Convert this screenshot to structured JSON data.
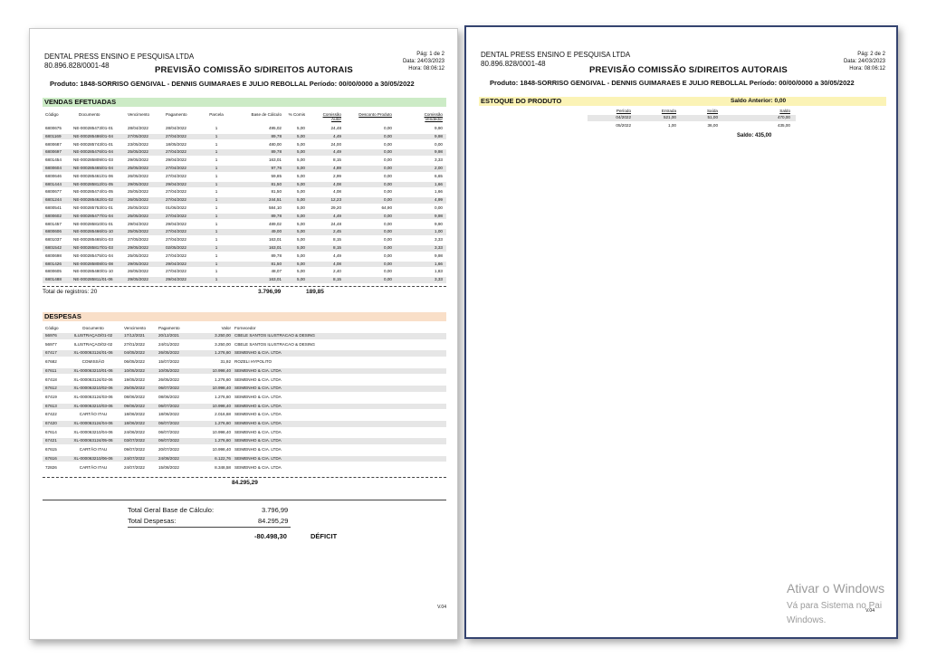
{
  "page1": {
    "company": "DENTAL PRESS ENSINO E PESQUISA LTDA",
    "cnpj": "80.896.828/0001-48",
    "page_label": "Pág: 1 de 2",
    "date_label": "Data: 24/03/2023",
    "time_label": "Hora: 08:06:12",
    "title": "PREVISÃO COMISSÃO S/DIREITOS AUTORAIS",
    "product_line": "Produto: 1848-SORRISO GENGIVAL - DENNIS GUIMARAES E JULIO REBOLLAL  Período: 00/00/0000 a 30/05/2022",
    "vendas": {
      "header": "VENDAS EFETUADAS",
      "cols": [
        "Código",
        "Documento",
        "Vencimento",
        "Pagamento",
        "Parcela",
        "Base de Cálculo",
        "% Comis",
        "Comissão Autor",
        "Desconto Produto",
        "Comissão Vendedor"
      ],
      "rows": [
        [
          "6800675",
          "NE-000285473/01-01",
          "28/04/2022",
          "28/04/2022",
          "1",
          "495,02",
          "5,00",
          "24,48",
          "0,00",
          "9,90"
        ],
        [
          "6801169",
          "NE-000285486/01-04",
          "27/05/2022",
          "27/04/2022",
          "1",
          "89,78",
          "5,00",
          "4,49",
          "0,00",
          "9,98"
        ],
        [
          "6800687",
          "NE-000285743/01-01",
          "23/05/2022",
          "18/05/2022",
          "1",
          "480,00",
          "5,00",
          "24,00",
          "0,00",
          "0,00"
        ],
        [
          "6800697",
          "NE-000285476/01-04",
          "25/05/2022",
          "27/04/2022",
          "1",
          "89,78",
          "5,00",
          "4,49",
          "0,00",
          "9,98"
        ],
        [
          "6801454",
          "NE-000285809/01-03",
          "29/05/2022",
          "29/04/2022",
          "1",
          "163,01",
          "5,00",
          "8,15",
          "0,00",
          "3,33"
        ],
        [
          "6800604",
          "NE-000285465/01-04",
          "25/05/2022",
          "27/04/2022",
          "1",
          "97,76",
          "5,00",
          "4,89",
          "0,00",
          "2,00"
        ],
        [
          "6800646",
          "NE-000285461/01-06",
          "26/05/2022",
          "27/04/2022",
          "1",
          "59,85",
          "5,00",
          "2,99",
          "0,00",
          "6,65"
        ],
        [
          "6801444",
          "NE-000285812/01-05",
          "29/05/2022",
          "29/04/2022",
          "1",
          "81,50",
          "5,00",
          "4,08",
          "0,00",
          "1,66"
        ],
        [
          "6800677",
          "NE-000285474/01-05",
          "25/05/2022",
          "27/04/2022",
          "1",
          "81,50",
          "5,00",
          "4,08",
          "0,00",
          "1,66"
        ],
        [
          "6801244",
          "NE-000285462/01-02",
          "26/05/2022",
          "27/04/2022",
          "1",
          "244,51",
          "5,00",
          "12,23",
          "0,00",
          "4,99"
        ],
        [
          "6800541",
          "NE-000285753/01-01",
          "25/05/2022",
          "01/06/2022",
          "1",
          "584,10",
          "5,00",
          "29,20",
          "64,90",
          "0,00"
        ],
        [
          "6800602",
          "NE-000285477/01-04",
          "25/05/2022",
          "27/04/2022",
          "1",
          "89,78",
          "5,00",
          "4,49",
          "0,00",
          "9,98"
        ],
        [
          "6801457",
          "NE-000285810/01-01",
          "29/04/2022",
          "29/04/2022",
          "1",
          "489,02",
          "5,00",
          "24,48",
          "0,00",
          "9,90"
        ],
        [
          "6800606",
          "NE-000285466/01-10",
          "25/05/2022",
          "27/04/2022",
          "1",
          "49,00",
          "5,00",
          "2,45",
          "0,00",
          "1,00"
        ],
        [
          "6801037",
          "NE-000285465/01-03",
          "27/05/2022",
          "27/04/2022",
          "1",
          "163,01",
          "5,00",
          "8,15",
          "0,00",
          "3,33"
        ],
        [
          "6801542",
          "NE-000285817/01-03",
          "29/05/2022",
          "02/05/2022",
          "1",
          "163,01",
          "5,00",
          "8,15",
          "0,00",
          "3,33"
        ],
        [
          "6800698",
          "NE-000285475/01-04",
          "25/05/2022",
          "27/04/2022",
          "1",
          "89,78",
          "5,00",
          "4,49",
          "0,00",
          "9,98"
        ],
        [
          "6801426",
          "NE-000285808/01-08",
          "29/05/2022",
          "29/04/2022",
          "1",
          "81,50",
          "5,00",
          "4,08",
          "0,00",
          "1,66"
        ],
        [
          "6800605",
          "NE-000285480/01-10",
          "26/05/2022",
          "27/04/2022",
          "1",
          "48,07",
          "5,00",
          "2,40",
          "0,00",
          "1,83"
        ],
        [
          "6801488",
          "NE-000285811/01-06",
          "29/05/2022",
          "29/04/2022",
          "1",
          "163,01",
          "5,00",
          "8,15",
          "0,00",
          "3,33"
        ]
      ],
      "total_label": "Total de registros: 20",
      "total_base": "3.796,99",
      "total_comissao": "189,85"
    },
    "despesas": {
      "header": "DESPESAS",
      "cols": [
        "Código",
        "Documento",
        "Vencimento",
        "Pagamento",
        "Valor",
        "Fornecedor"
      ],
      "rows": [
        [
          "56976",
          "ILUSTRAÇAO/01-02",
          "17/12/2021",
          "20/12/2021",
          "3.250,00",
          "CBELE SANTOS ILUSTRACAO & DESING"
        ],
        [
          "56977",
          "ILUSTRAÇAO/02-02",
          "27/01/2022",
          "24/01/2022",
          "3.250,00",
          "CBELE SANTOS ILUSTRACAO & DESING"
        ],
        [
          "67417",
          "XL-000063124/01-06",
          "04/05/2022",
          "26/05/2022",
          "1.276,60",
          "SEIMENHO & CIA. LTDA"
        ],
        [
          "67682",
          "COMISSÃO",
          "06/05/2022",
          "15/07/2022",
          "31,92",
          "ROZELI HYPOLITO"
        ],
        [
          "67611",
          "XL-000063210/01-06",
          "10/05/2022",
          "10/05/2022",
          "10.998,40",
          "SEIMENHO & CIA. LTDA"
        ],
        [
          "67418",
          "XL-000063124/02-06",
          "19/05/2022",
          "26/05/2022",
          "1.276,60",
          "SEIMENHO & CIA. LTDA"
        ],
        [
          "67612",
          "XL-000063210/02-06",
          "25/05/2022",
          "06/07/2022",
          "10.998,40",
          "SEIMENHO & CIA. LTDA"
        ],
        [
          "67419",
          "XL-000063124/03-06",
          "08/06/2022",
          "08/06/2022",
          "1.276,60",
          "SEIMENHO & CIA. LTDA"
        ],
        [
          "67613",
          "XL-000063210/03-06",
          "09/06/2022",
          "06/07/2022",
          "10.998,40",
          "SEIMENHO & CIA. LTDA"
        ],
        [
          "67422",
          "CARTÃO ITAU",
          "18/06/2022",
          "18/06/2022",
          "2.016,68",
          "SEIMENHO & CIA. LTDA"
        ],
        [
          "67420",
          "XL-000063124/04-06",
          "18/06/2022",
          "06/07/2022",
          "1.276,60",
          "SEIMENHO & CIA. LTDA"
        ],
        [
          "67614",
          "XL-000063210/04-06",
          "24/06/2022",
          "06/07/2022",
          "10.998,40",
          "SEIMENHO & CIA. LTDA"
        ],
        [
          "67421",
          "XL-000063124/05-06",
          "03/07/2022",
          "06/07/2022",
          "1.276,60",
          "SEIMENHO & CIA. LTDA"
        ],
        [
          "67615",
          "CARTÃO ITAU",
          "09/07/2022",
          "20/07/2022",
          "10.998,40",
          "SEIMENHO & CIA. LTDA"
        ],
        [
          "67616",
          "XL-000063210/06-06",
          "24/07/2022",
          "24/08/2022",
          "6.122,76",
          "SEIMENHO & CIA. LTDA"
        ],
        [
          "72826",
          "CARTÃO ITAU",
          "24/07/2022",
          "15/08/2022",
          "8.348,58",
          "SEIMENHO & CIA. LTDA"
        ]
      ],
      "total": "84.295,29"
    },
    "summary": {
      "base_label": "Total Geral Base de Cálculo:",
      "base_value": "3.796,99",
      "desp_label": "Total Despesas:",
      "desp_value": "84.295,29",
      "result_value": "-80.498,30",
      "result_label": "DÉFICIT"
    },
    "version": "V.04"
  },
  "page2": {
    "company": "DENTAL PRESS ENSINO E PESQUISA LTDA",
    "cnpj": "80.896.828/0001-48",
    "page_label": "Pág: 2 de 2",
    "date_label": "Data: 24/03/2023",
    "time_label": "Hora: 08:06:12",
    "title": "PREVISÃO COMISSÃO S/DIREITOS AUTORAIS",
    "product_line": "Produto: 1848-SORRISO GENGIVAL - DENNIS GUIMARAES E JULIO REBOLLAL  Período: 00/00/0000 a 30/05/2022",
    "estoque": {
      "header": "ESTOQUE DO PRODUTO",
      "saldo_anterior": "Saldo Anterior: 0,00",
      "cols": [
        "Período",
        "Entrada",
        "Saída",
        "Saldo"
      ],
      "rows": [
        [
          "04/2022",
          "521,00",
          "51,00",
          "470,00"
        ],
        [
          "05/2022",
          "1,00",
          "36,00",
          "435,00"
        ]
      ],
      "saldo_final": "Saldo: 435,00"
    },
    "version": "V.04"
  },
  "watermark": {
    "line1": "Ativar o Windows",
    "line2": "Vá para Sistema no Pai",
    "line3": "Windows."
  },
  "colors": {
    "vendas_band": "#ccebc6",
    "despesas_band": "#f9dfc8",
    "estoque_band": "#fbf3b6",
    "page2_border": "#34436f"
  }
}
